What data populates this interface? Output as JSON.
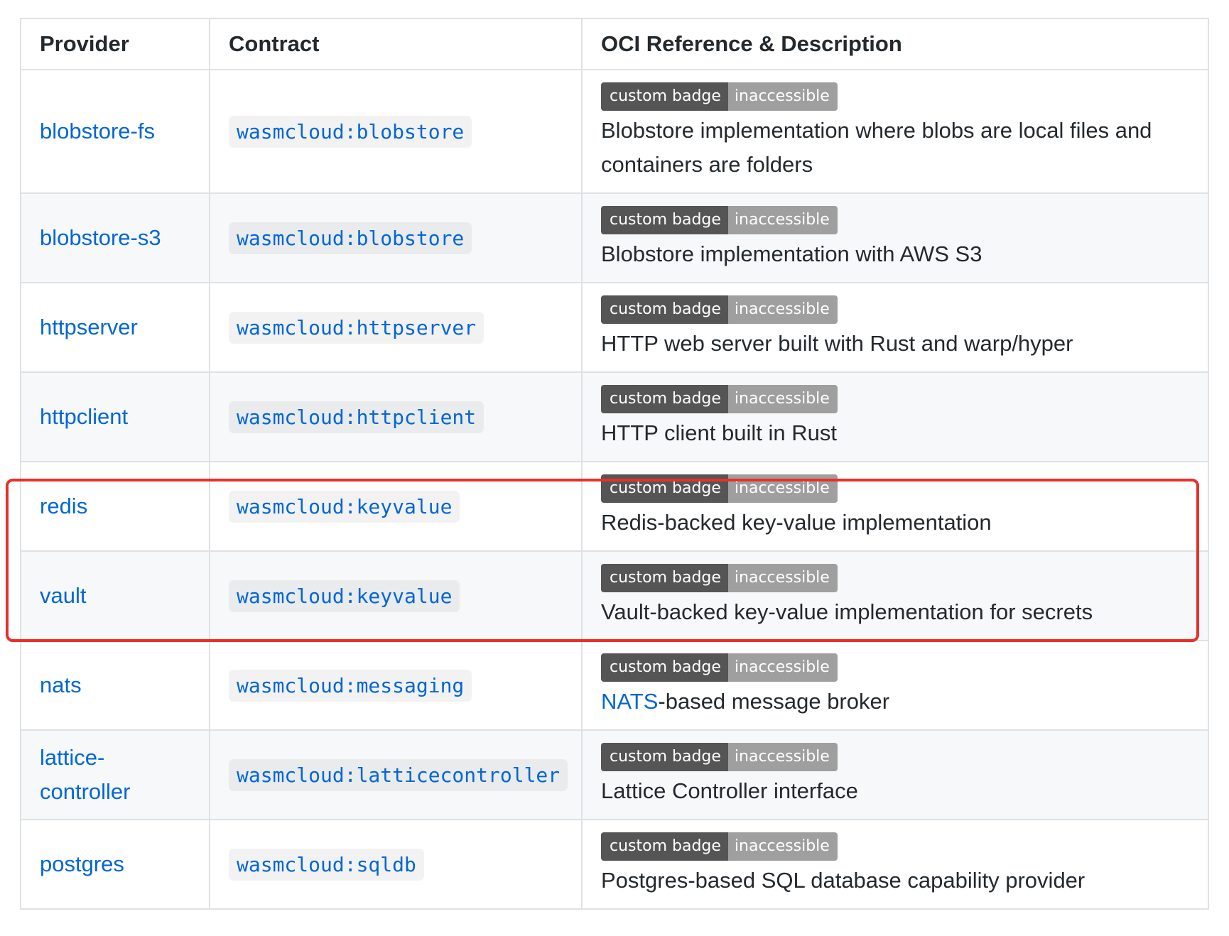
{
  "headers": {
    "provider": "Provider",
    "contract": "Contract",
    "oci": "OCI Reference & Description"
  },
  "badge": {
    "left": "custom badge",
    "right": "inaccessible",
    "left_color": "#555555",
    "right_color": "#9f9f9f"
  },
  "rows": [
    {
      "provider": "blobstore-fs",
      "contract": "wasmcloud:blobstore",
      "description": "Blobstore implementation where blobs are local files and containers are folders"
    },
    {
      "provider": "blobstore-s3",
      "contract": "wasmcloud:blobstore",
      "description": "Blobstore implementation with AWS S3"
    },
    {
      "provider": "httpserver",
      "contract": "wasmcloud:httpserver",
      "description": "HTTP web server built with Rust and warp/hyper"
    },
    {
      "provider": "httpclient",
      "contract": "wasmcloud:httpclient",
      "description": "HTTP client built in Rust"
    },
    {
      "provider": "redis",
      "contract": "wasmcloud:keyvalue",
      "description": "Redis-backed key-value implementation"
    },
    {
      "provider": "vault",
      "contract": "wasmcloud:keyvalue",
      "description": "Vault-backed key-value implementation for secrets"
    },
    {
      "provider": "nats",
      "contract": "wasmcloud:messaging",
      "description_link": "NATS",
      "description_rest": "-based message broker"
    },
    {
      "provider": "lattice-controller",
      "provider_line1": "lattice-",
      "provider_line2": "controller",
      "contract": "wasmcloud:latticecontroller",
      "description": "Lattice Controller interface"
    },
    {
      "provider": "postgres",
      "contract": "wasmcloud:sqldb",
      "description": "Postgres-based SQL database capability provider"
    }
  ],
  "colors": {
    "link": "#0366d6",
    "highlight_border": "#e8302a",
    "alt_row": "#f6f8fa",
    "border": "#dfe2e5"
  }
}
